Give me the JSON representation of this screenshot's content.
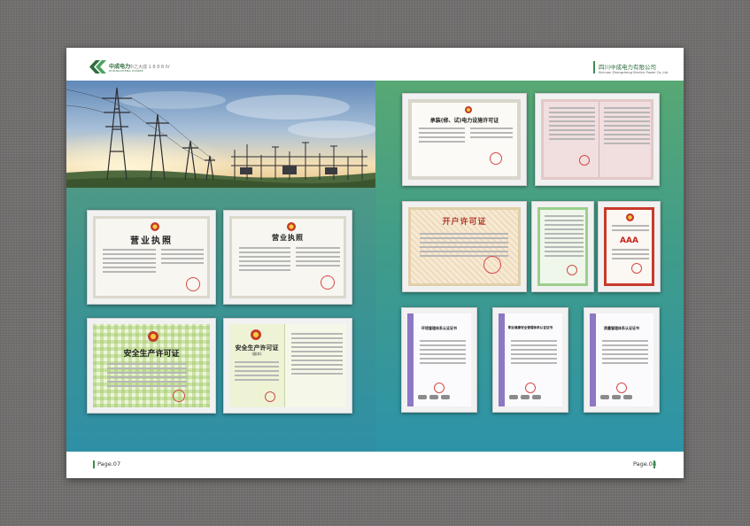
{
  "header": {
    "logo_name": "中成电力",
    "logo_sub": "ZHONGCHENG POWER",
    "slogan": "中之大成 1 8 8 8 IV",
    "company_cn": "四川中成电力有限公司",
    "company_en": "Sichuan Zhongcheng Electric Power Co.,Ltd"
  },
  "footer": {
    "page_left": "Page.07",
    "page_right": "Page.08"
  },
  "certificates": {
    "license1": {
      "title": "营业执照"
    },
    "license2": {
      "title": "营业执照"
    },
    "safety1": {
      "title": "安全生产许可证"
    },
    "safety2": {
      "title": "安全生产许可证",
      "sub": "(副本)"
    },
    "power": {
      "title": "承装(修、试)电力设施许可证"
    },
    "account": {
      "title": "开户许可证"
    },
    "credit": {
      "title": "AAA"
    },
    "env": {
      "title": "环境管理体系认证证书"
    },
    "ohs": {
      "title": "职业健康安全管理体系认证证书"
    },
    "quality": {
      "title": "质量管理体系认证证书"
    }
  },
  "colors": {
    "brand_green": "#2f6b3e",
    "accent_green": "#3f8c53",
    "seal_red": "#d44a4a"
  }
}
